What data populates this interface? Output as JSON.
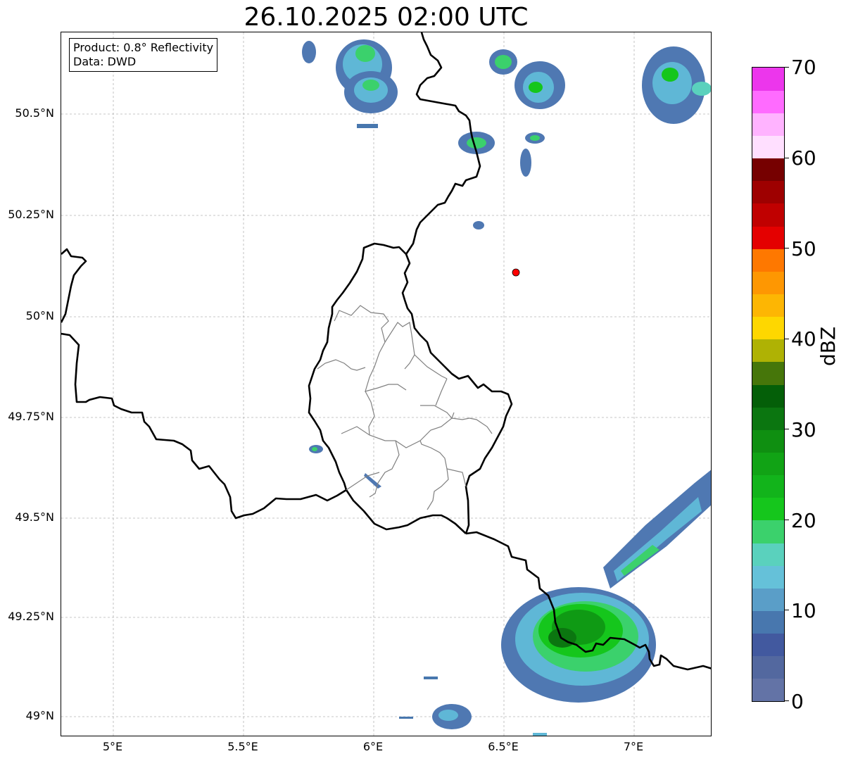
{
  "title": "26.10.2025 02:00 UTC",
  "info": {
    "product": "Product: 0.8° Reflectivity",
    "source": "Data: DWD"
  },
  "axes": {
    "lon_ticks": [
      "5°E",
      "5.5°E",
      "6°E",
      "6.5°E",
      "7°E"
    ],
    "lat_ticks": [
      "50.5°N",
      "50.25°N",
      "50°N",
      "49.75°N",
      "49.5°N",
      "49.25°N",
      "49°N"
    ]
  },
  "colorbar": {
    "label": "dBZ",
    "tick_labels": [
      "0",
      "10",
      "20",
      "30",
      "40",
      "50",
      "60",
      "70"
    ],
    "range": [
      0,
      70
    ],
    "colors": [
      "#6373a6",
      "#53689f",
      "#42599f",
      "#4877ae",
      "#5a9ec8",
      "#65c1d9",
      "#5ad1bd",
      "#3bd16c",
      "#15c61c",
      "#12b41b",
      "#11a315",
      "#0f8f11",
      "#0b7610",
      "#045f08",
      "#46760a",
      "#afb204",
      "#fed700",
      "#fdb603",
      "#fe9702",
      "#fe7800",
      "#e40000",
      "#c00000",
      "#9e0000",
      "#760000",
      "#ffdfff",
      "#ffb3ff",
      "#ff6bff",
      "#ec36ec"
    ]
  },
  "radar_marker": {
    "lon": 6.55,
    "lat": 50.107,
    "color": "#ff0000"
  },
  "map_colors": {
    "border": "#000000",
    "admin": "#808080",
    "grid": "#b5b5b5"
  }
}
